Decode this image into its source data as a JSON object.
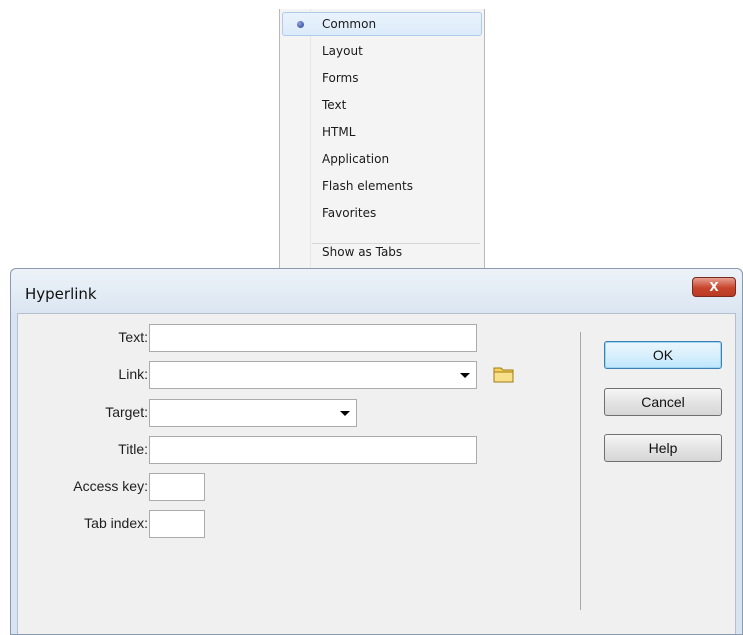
{
  "menu": {
    "items": [
      {
        "label": "Common",
        "selected": true
      },
      {
        "label": "Layout",
        "selected": false
      },
      {
        "label": "Forms",
        "selected": false
      },
      {
        "label": "Text",
        "selected": false
      },
      {
        "label": "HTML",
        "selected": false
      },
      {
        "label": "Application",
        "selected": false
      },
      {
        "label": "Flash elements",
        "selected": false
      },
      {
        "label": "Favorites",
        "selected": false
      }
    ],
    "show_as_tabs": "Show as Tabs"
  },
  "dialog": {
    "title": "Hyperlink",
    "close_glyph": "X",
    "labels": {
      "text": "Text:",
      "link": "Link:",
      "target": "Target:",
      "title": "Title:",
      "access_key": "Access key:",
      "tab_index": "Tab index:"
    },
    "values": {
      "text": "",
      "link": "",
      "target": "",
      "title": "",
      "access_key": "",
      "tab_index": ""
    },
    "buttons": {
      "ok": "OK",
      "cancel": "Cancel",
      "help": "Help"
    }
  },
  "colors": {
    "close_button": "#c7452c",
    "selected_item": "#dcebfa",
    "default_button_border": "#3c7fb1"
  }
}
